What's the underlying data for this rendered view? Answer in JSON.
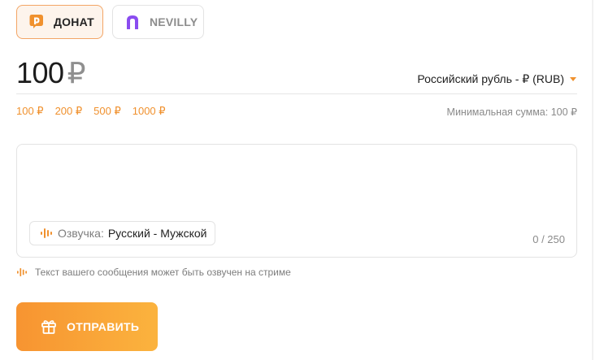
{
  "tabs": [
    {
      "label": "ДОНАТ",
      "icon": "donat-logo-icon",
      "active": true
    },
    {
      "label": "NEVILLY",
      "icon": "nevilly-logo-icon",
      "active": false
    }
  ],
  "amount": {
    "value": "100",
    "currency_symbol": "₽"
  },
  "currency_select": {
    "selected": "Российский рубль - ₽ (RUB)"
  },
  "presets": [
    "100 ₽",
    "200 ₽",
    "500 ₽",
    "1000 ₽"
  ],
  "min_sum": "Минимальная сумма: 100 ₽",
  "message": {
    "value": "",
    "voice_label": "Озвучка:",
    "voice_value": "Русский - Мужской",
    "counter": "0 / 250"
  },
  "tts_note": "Текст вашего сообщения может быть озвучен на стриме",
  "submit_label": "ОТПРАВИТЬ",
  "colors": {
    "accent": "#f0912e",
    "accent_light": "#fdf4ec",
    "nevilly_purple": "#8a4cf0"
  }
}
